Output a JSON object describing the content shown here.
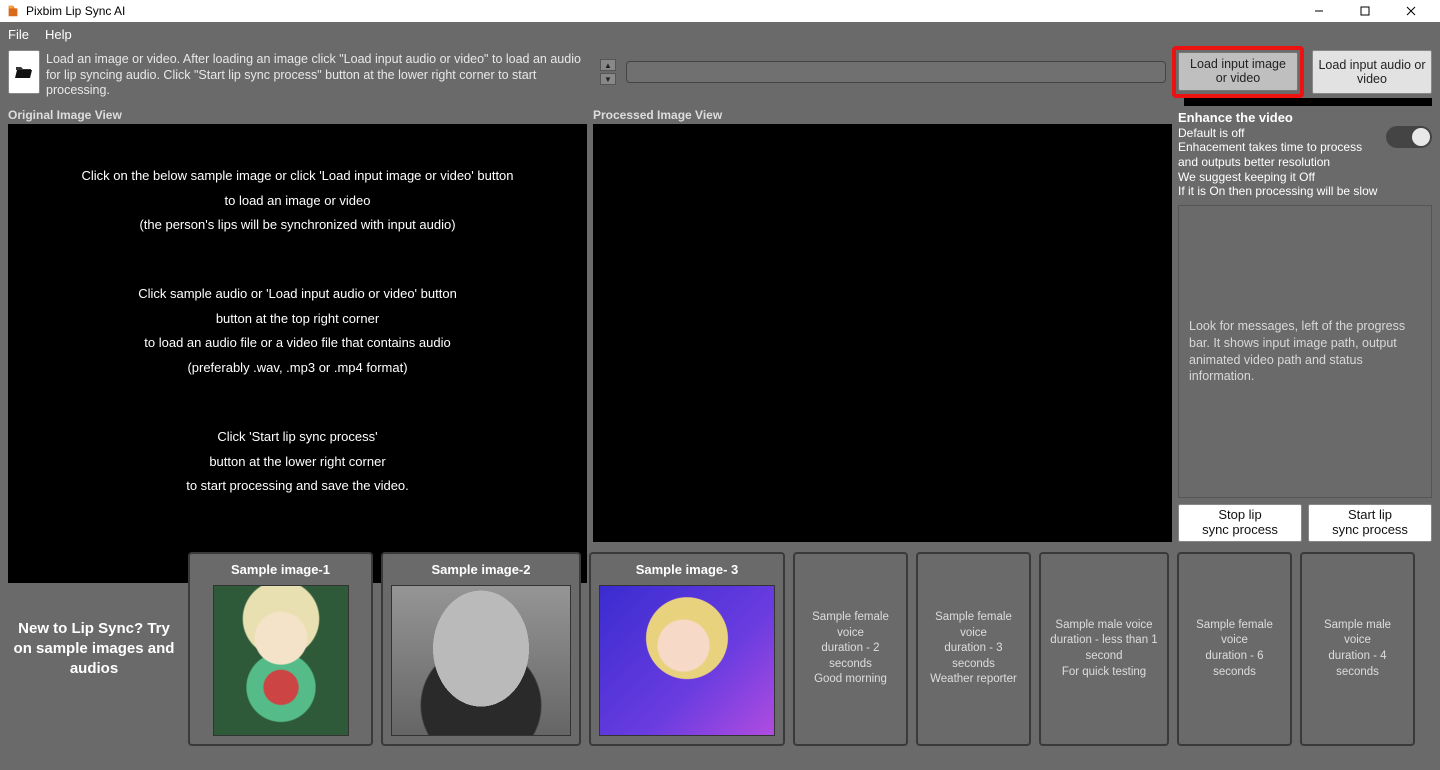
{
  "window": {
    "title": "Pixbim Lip Sync AI"
  },
  "menu": {
    "file": "File",
    "help": "Help"
  },
  "toolbar": {
    "hint": "Load an image or video. After loading an image click \"Load input audio or video\" to load an audio for lip syncing audio. Click \"Start lip sync process\" button at the lower right corner to start processing.",
    "path_value": "",
    "load_image_btn": "Load input image or video",
    "load_audio_btn": "Load input audio or video"
  },
  "views": {
    "original_header": "Original Image View",
    "processed_header": "Processed Image View",
    "instructions": {
      "b1l1": "Click on the below sample image or click 'Load input image or video' button",
      "b1l2": "to load an image or video",
      "b1l3": "(the person's lips will be synchronized with input audio)",
      "b2l1": "Click sample audio or 'Load input audio or video' button",
      "b2l2": "button at the top right corner",
      "b2l3": "to load an audio file or a video file that contains audio",
      "b2l4": "(preferably .wav, .mp3 or .mp4 format)",
      "b3l1": "Click 'Start lip sync process'",
      "b3l2": "button at the lower right corner",
      "b3l3": "to start processing and save the video."
    }
  },
  "side": {
    "enhance_title": "Enhance the video",
    "enhance_l1": "Default is off",
    "enhance_l2": "Enhacement takes time to process and outputs better resolution",
    "enhance_l3": "We suggest keeping it Off",
    "enhance_l4": "If it is On then processing will be slow",
    "msg": "Look for messages, left of the progress bar. It shows input image path, output animated video path and status information.",
    "stop_btn_l1": "Stop lip",
    "stop_btn_l2": "sync process",
    "start_btn_l1": "Start lip",
    "start_btn_l2": "sync process"
  },
  "samples": {
    "intro": "New to Lip Sync? Try on sample images and audios",
    "img1": "Sample image-1",
    "img2": "Sample image-2",
    "img3": "Sample image- 3",
    "a1l1": "Sample female voice",
    "a1l2": "duration - 2 seconds",
    "a1l3": "Good morning",
    "a2l1": "Sample female voice",
    "a2l2": "duration - 3 seconds",
    "a2l3": "Weather reporter",
    "a3l1": "Sample male voice",
    "a3l2": "duration - less than 1 second",
    "a3l3": "For quick testing",
    "a4l1": "Sample female voice",
    "a4l2": "duration - 6 seconds",
    "a5l1": "Sample male voice",
    "a5l2": "duration - 4 seconds"
  }
}
